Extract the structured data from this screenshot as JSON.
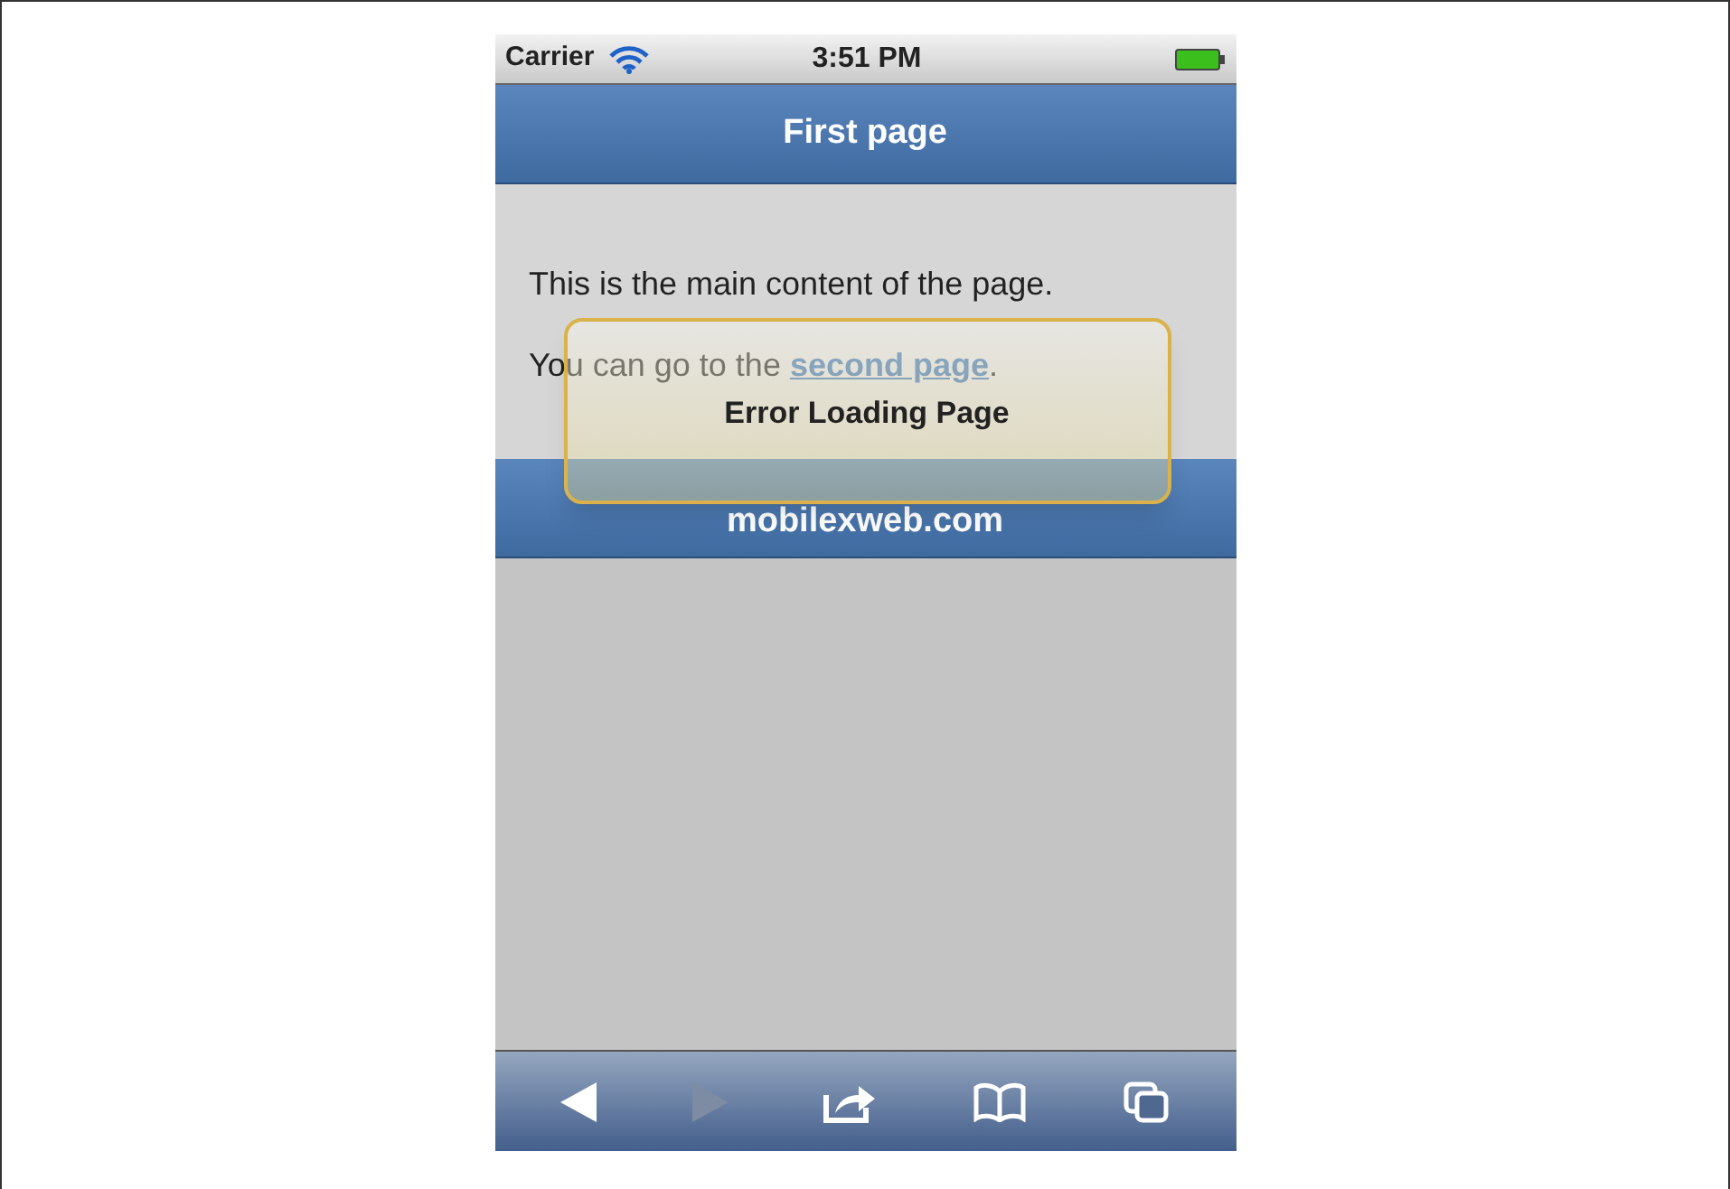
{
  "status_bar": {
    "carrier": "Carrier",
    "time": "3:51 PM"
  },
  "header": {
    "title": "First page"
  },
  "content": {
    "paragraph": "This is the main content of the page.",
    "link_paragraph": {
      "before": "You can go to the ",
      "link": "second page",
      "after": "."
    }
  },
  "footer": {
    "text": "mobilexweb.com"
  },
  "alert": {
    "message": "Error Loading Page"
  },
  "toolbar": [
    {
      "kind": "back",
      "disabled": false
    },
    {
      "kind": "forward",
      "disabled": true
    },
    {
      "kind": "share",
      "disabled": false
    },
    {
      "kind": "bookmarks",
      "disabled": false
    },
    {
      "kind": "pages",
      "disabled": false
    }
  ]
}
